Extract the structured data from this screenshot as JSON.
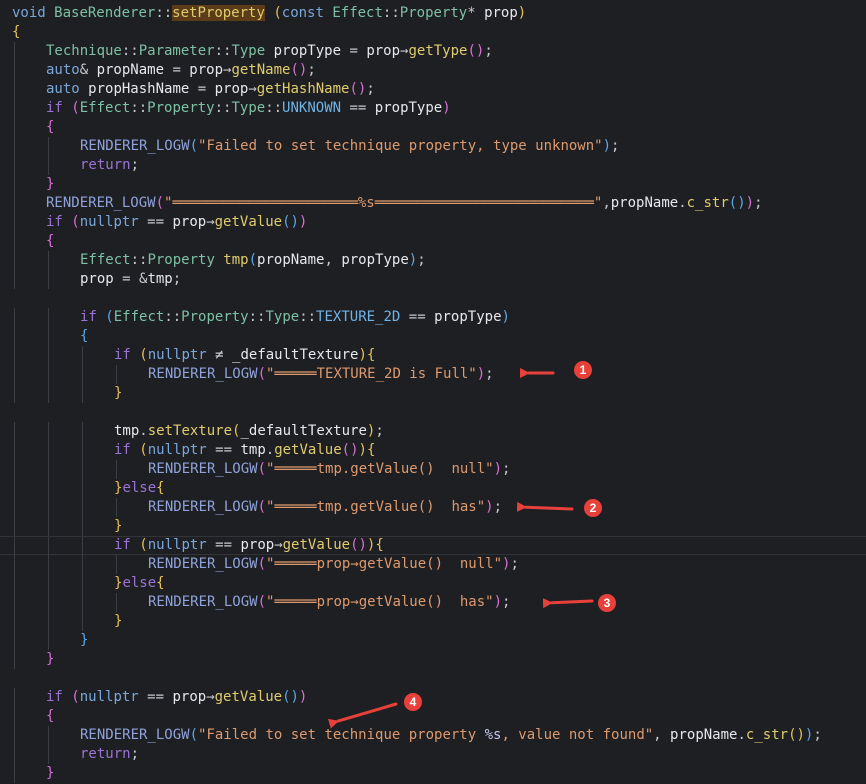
{
  "editor": {
    "lines": [
      [
        [
          "kwc",
          "void "
        ],
        [
          "type",
          "BaseRenderer"
        ],
        [
          "op",
          "::"
        ],
        [
          "fnh",
          "setProperty"
        ],
        [
          "op",
          " "
        ],
        [
          "brace1",
          "("
        ],
        [
          "kwc",
          "const "
        ],
        [
          "type",
          "Effect"
        ],
        [
          "op",
          "::"
        ],
        [
          "type",
          "Property"
        ],
        [
          "op",
          "* "
        ],
        [
          "var",
          "prop"
        ],
        [
          "brace1",
          ")"
        ]
      ],
      [
        [
          "brace1",
          "{"
        ]
      ],
      [
        [
          "type",
          "Technique"
        ],
        [
          "op",
          "::"
        ],
        [
          "type",
          "Parameter"
        ],
        [
          "op",
          "::"
        ],
        [
          "type",
          "Type "
        ],
        [
          "var",
          "propType "
        ],
        [
          "op",
          "= "
        ],
        [
          "var",
          "prop"
        ],
        [
          "op",
          "→"
        ],
        [
          "fn",
          "getType"
        ],
        [
          "brace2",
          "()"
        ],
        [
          "op",
          ";"
        ]
      ],
      [
        [
          "kwc",
          "auto"
        ],
        [
          "op",
          "& "
        ],
        [
          "var",
          "propName "
        ],
        [
          "op",
          "= "
        ],
        [
          "var",
          "prop"
        ],
        [
          "op",
          "→"
        ],
        [
          "fn",
          "getName"
        ],
        [
          "brace2",
          "()"
        ],
        [
          "op",
          ";"
        ]
      ],
      [
        [
          "kwc",
          "auto "
        ],
        [
          "var",
          "propHashName "
        ],
        [
          "op",
          "= "
        ],
        [
          "var",
          "prop"
        ],
        [
          "op",
          "→"
        ],
        [
          "fn",
          "getHashName"
        ],
        [
          "brace2",
          "()"
        ],
        [
          "op",
          ";"
        ]
      ],
      [
        [
          "kw",
          "if "
        ],
        [
          "brace2",
          "("
        ],
        [
          "type",
          "Effect"
        ],
        [
          "op",
          "::"
        ],
        [
          "type",
          "Property"
        ],
        [
          "op",
          "::"
        ],
        [
          "type",
          "Type"
        ],
        [
          "op",
          "::"
        ],
        [
          "const",
          "UNKNOWN "
        ],
        [
          "op",
          "== "
        ],
        [
          "var",
          "propType"
        ],
        [
          "brace2",
          ")"
        ]
      ],
      [
        [
          "brace2",
          "{"
        ]
      ],
      [
        [
          "mac",
          "RENDERER_LOGW"
        ],
        [
          "brace3",
          "("
        ],
        [
          "str",
          "\"Failed to set technique property, type unknown\""
        ],
        [
          "brace3",
          ")"
        ],
        [
          "op",
          ";"
        ]
      ],
      [
        [
          "kw",
          "return"
        ],
        [
          "op",
          ";"
        ]
      ],
      [
        [
          "brace2",
          "}"
        ]
      ],
      [
        [
          "mac",
          "RENDERER_LOGW"
        ],
        [
          "brace2",
          "("
        ],
        [
          "str",
          "\"══════════════════════%s══════════════════════════\""
        ],
        [
          "op",
          ","
        ],
        [
          "var",
          "propName"
        ],
        [
          "op",
          "."
        ],
        [
          "fn",
          "c_str"
        ],
        [
          "brace3",
          "()"
        ],
        [
          "brace2",
          ")"
        ],
        [
          "op",
          ";"
        ]
      ],
      [
        [
          "kw",
          "if "
        ],
        [
          "brace2",
          "("
        ],
        [
          "kwc",
          "nullptr "
        ],
        [
          "op",
          "== "
        ],
        [
          "var",
          "prop"
        ],
        [
          "op",
          "→"
        ],
        [
          "fn",
          "getValue"
        ],
        [
          "brace3",
          "()"
        ],
        [
          "brace2",
          ")"
        ]
      ],
      [
        [
          "brace2",
          "{"
        ]
      ],
      [
        [
          "type",
          "Effect"
        ],
        [
          "op",
          "::"
        ],
        [
          "type",
          "Property "
        ],
        [
          "fn",
          "tmp"
        ],
        [
          "brace3",
          "("
        ],
        [
          "var",
          "propName"
        ],
        [
          "op",
          ", "
        ],
        [
          "var",
          "propType"
        ],
        [
          "brace3",
          ")"
        ],
        [
          "op",
          ";"
        ]
      ],
      [
        [
          "var",
          "prop "
        ],
        [
          "op",
          "= "
        ],
        [
          "op",
          "&"
        ],
        [
          "var",
          "tmp"
        ],
        [
          "op",
          ";"
        ]
      ],
      [],
      [
        [
          "kw",
          "if "
        ],
        [
          "brace3",
          "("
        ],
        [
          "type",
          "Effect"
        ],
        [
          "op",
          "::"
        ],
        [
          "type",
          "Property"
        ],
        [
          "op",
          "::"
        ],
        [
          "type",
          "Type"
        ],
        [
          "op",
          "::"
        ],
        [
          "const",
          "TEXTURE_2D "
        ],
        [
          "op",
          "== "
        ],
        [
          "var",
          "propType"
        ],
        [
          "brace3",
          ")"
        ]
      ],
      [
        [
          "brace3",
          "{"
        ]
      ],
      [
        [
          "kw",
          "if "
        ],
        [
          "brace1",
          "("
        ],
        [
          "kwc",
          "nullptr "
        ],
        [
          "op",
          "≠ "
        ],
        [
          "var",
          "_defaultTexture"
        ],
        [
          "brace1",
          ")"
        ],
        [
          "brace1",
          "{"
        ]
      ],
      [
        [
          "mac",
          "RENDERER_LOGW"
        ],
        [
          "brace2",
          "("
        ],
        [
          "str",
          "\"═════TEXTURE_2D is Full\""
        ],
        [
          "brace2",
          ")"
        ],
        [
          "op",
          ";"
        ]
      ],
      [
        [
          "brace1",
          "}"
        ]
      ],
      [],
      [
        [
          "var",
          "tmp"
        ],
        [
          "op",
          "."
        ],
        [
          "fn",
          "setTexture"
        ],
        [
          "brace1",
          "("
        ],
        [
          "var",
          "_defaultTexture"
        ],
        [
          "brace1",
          ")"
        ],
        [
          "op",
          ";"
        ]
      ],
      [
        [
          "kw",
          "if "
        ],
        [
          "brace1",
          "("
        ],
        [
          "kwc",
          "nullptr "
        ],
        [
          "op",
          "== "
        ],
        [
          "var",
          "tmp"
        ],
        [
          "op",
          "."
        ],
        [
          "fn",
          "getValue"
        ],
        [
          "brace2",
          "()"
        ],
        [
          "brace1",
          ")"
        ],
        [
          "brace1",
          "{"
        ]
      ],
      [
        [
          "mac",
          "RENDERER_LOGW"
        ],
        [
          "brace2",
          "("
        ],
        [
          "str",
          "\"═════tmp.getValue()  null\""
        ],
        [
          "brace2",
          ")"
        ],
        [
          "op",
          ";"
        ]
      ],
      [
        [
          "brace1",
          "}"
        ],
        [
          "kw",
          "else"
        ],
        [
          "brace1",
          "{"
        ]
      ],
      [
        [
          "mac",
          "RENDERER_LOGW"
        ],
        [
          "brace2",
          "("
        ],
        [
          "str",
          "\"═════tmp.getValue()  has\""
        ],
        [
          "brace2",
          ")"
        ],
        [
          "op",
          ";"
        ]
      ],
      [
        [
          "brace1",
          "}"
        ]
      ],
      [
        [
          "kw",
          "if "
        ],
        [
          "brace1",
          "("
        ],
        [
          "kwc",
          "nullptr "
        ],
        [
          "op",
          "== "
        ],
        [
          "var",
          "prop"
        ],
        [
          "op",
          "→"
        ],
        [
          "fn",
          "getValue"
        ],
        [
          "brace2",
          "()"
        ],
        [
          "brace1",
          ")"
        ],
        [
          "brace1",
          "{"
        ]
      ],
      [
        [
          "mac",
          "RENDERER_LOGW"
        ],
        [
          "brace2",
          "("
        ],
        [
          "str",
          "\"═════prop→getValue()  null\""
        ],
        [
          "brace2",
          ")"
        ],
        [
          "op",
          ";"
        ]
      ],
      [
        [
          "brace1",
          "}"
        ],
        [
          "kw",
          "else"
        ],
        [
          "brace1",
          "{"
        ]
      ],
      [
        [
          "mac",
          "RENDERER_LOGW"
        ],
        [
          "brace2",
          "("
        ],
        [
          "str",
          "\"═════prop→getValue()  has\""
        ],
        [
          "brace2",
          ")"
        ],
        [
          "op",
          ";"
        ]
      ],
      [
        [
          "brace1",
          "}"
        ]
      ],
      [
        [
          "brace3",
          "}"
        ]
      ],
      [
        [
          "brace2",
          "}"
        ]
      ],
      [],
      [
        [
          "kw",
          "if "
        ],
        [
          "brace2",
          "("
        ],
        [
          "kwc",
          "nullptr "
        ],
        [
          "op",
          "== "
        ],
        [
          "var",
          "prop"
        ],
        [
          "op",
          "→"
        ],
        [
          "fn",
          "getValue"
        ],
        [
          "brace3",
          "()"
        ],
        [
          "brace2",
          ")"
        ]
      ],
      [
        [
          "brace2",
          "{"
        ]
      ],
      [
        [
          "mac",
          "RENDERER_LOGW"
        ],
        [
          "brace3",
          "("
        ],
        [
          "str",
          "\"Failed to set technique property "
        ],
        [
          "vari",
          "%s"
        ],
        [
          "str",
          ", value not found\""
        ],
        [
          "op",
          ", "
        ],
        [
          "var",
          "propName"
        ],
        [
          "op",
          "."
        ],
        [
          "fn",
          "c_str"
        ],
        [
          "brace1",
          "()"
        ],
        [
          "brace3",
          ")"
        ],
        [
          "op",
          ";"
        ]
      ],
      [
        [
          "kw",
          "return"
        ],
        [
          "op",
          ";"
        ]
      ],
      [
        [
          "brace2",
          "}"
        ]
      ]
    ],
    "indents": [
      0,
      0,
      1,
      1,
      1,
      1,
      1,
      2,
      2,
      1,
      1,
      1,
      1,
      2,
      2,
      0,
      2,
      2,
      3,
      4,
      3,
      0,
      3,
      3,
      4,
      3,
      4,
      3,
      3,
      4,
      3,
      4,
      3,
      2,
      1,
      0,
      1,
      1,
      2,
      2,
      1
    ],
    "current_line": 28
  },
  "annotations": [
    {
      "label": "1",
      "line": 19
    },
    {
      "label": "2",
      "line": 26
    },
    {
      "label": "3",
      "line": 31
    },
    {
      "label": "4",
      "line": 37
    }
  ],
  "colors": {
    "arrow": "#e8403a",
    "badge": "#e8403a"
  }
}
